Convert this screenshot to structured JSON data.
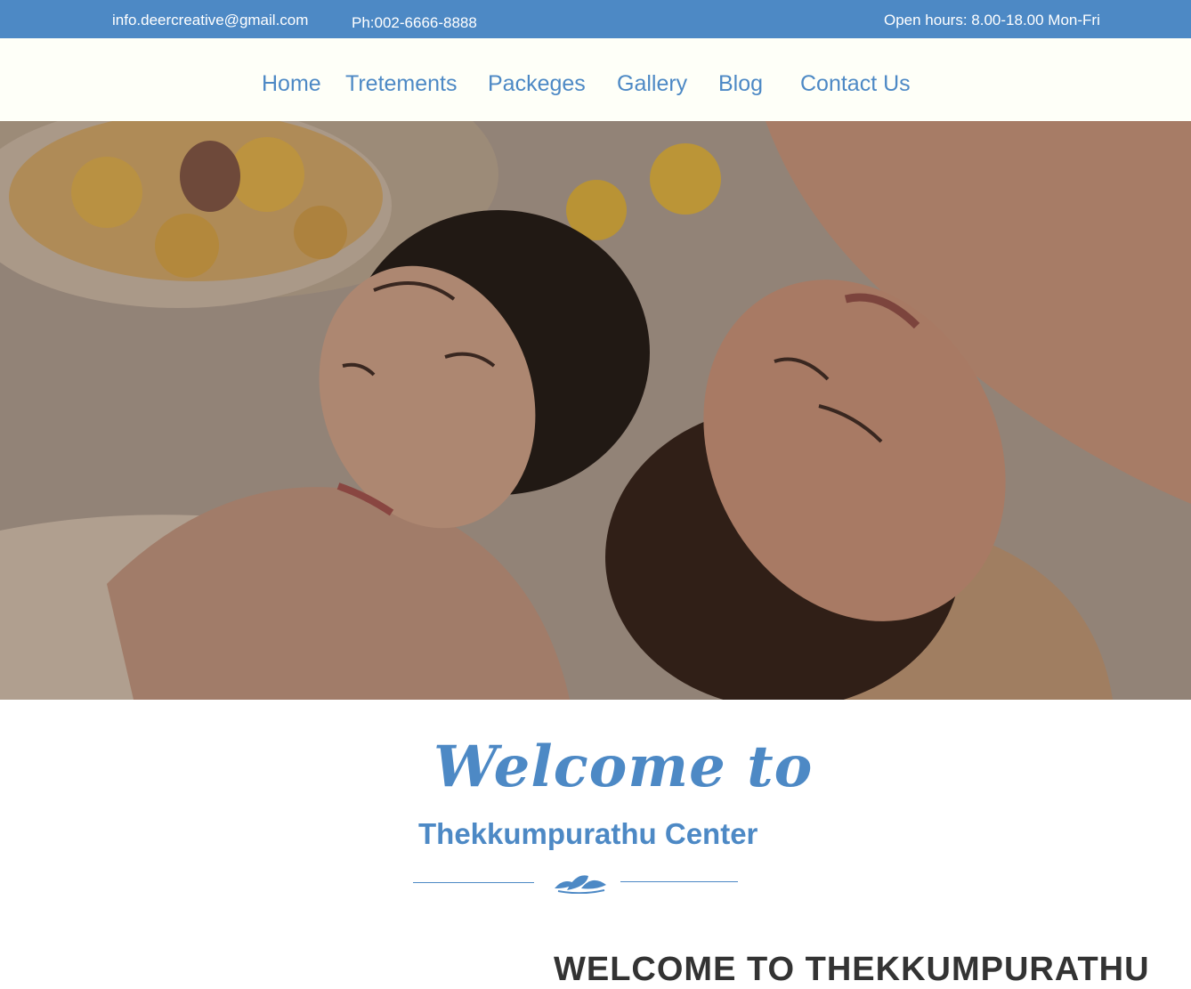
{
  "topbar": {
    "email": "info.deercreative@gmail.com",
    "phone": "Ph:002-6666-8888",
    "hours": "Open hours: 8.00-18.00 Mon-Fri"
  },
  "nav": {
    "items": [
      {
        "label": "Home"
      },
      {
        "label": "Tretements"
      },
      {
        "label": "Packeges"
      },
      {
        "label": "Gallery"
      },
      {
        "label": "Blog"
      },
      {
        "label": "Contact Us"
      }
    ]
  },
  "welcome": {
    "script_title": "Welcome to",
    "subtitle": "Thekkumpurathu Center",
    "section_heading": "WELCOME TO THEKKUMPURATHU"
  },
  "colors": {
    "brand_blue": "#4d89c5",
    "nav_bg": "#fefff8"
  },
  "icons": {
    "divider": "lotus-icon"
  }
}
